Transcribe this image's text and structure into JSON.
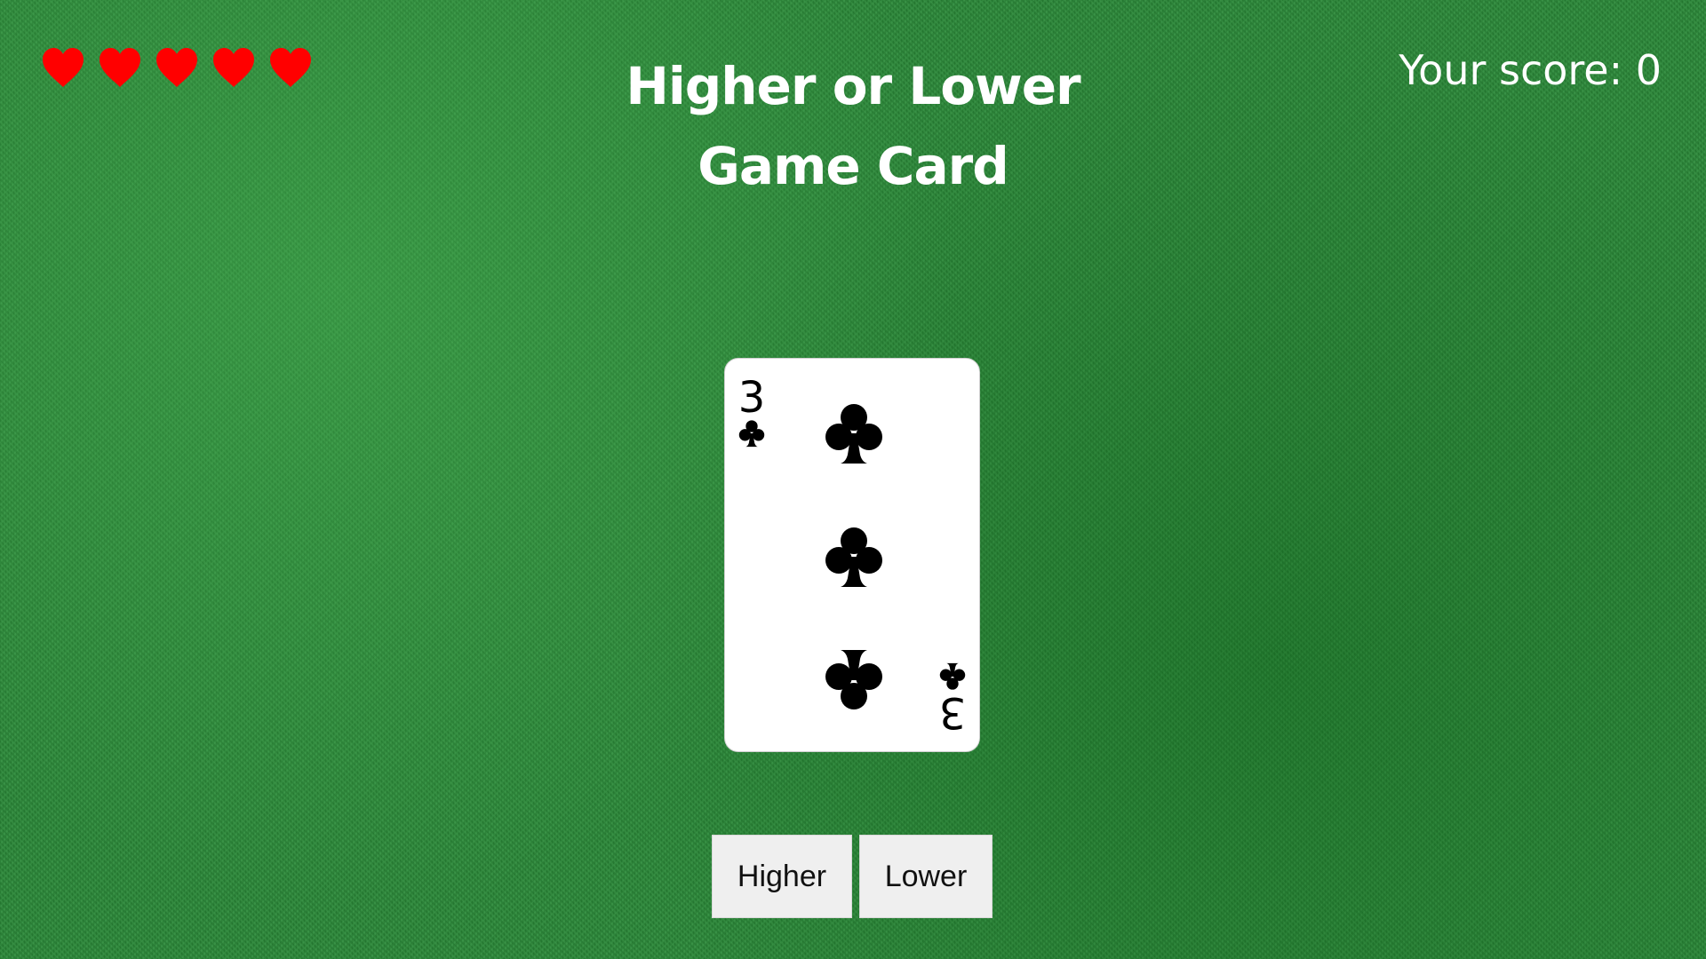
{
  "game": {
    "title_line1": "Higher or Lower",
    "title_line2": "Game Card",
    "score_label": "Your score: 0",
    "score": 0,
    "lives": 5,
    "life_icon": "heart-icon",
    "life_color": "#ff0000"
  },
  "card": {
    "rank": "3",
    "suit": "clubs",
    "suit_icon": "club-icon",
    "color": "#000000"
  },
  "controls": {
    "higher_label": "Higher",
    "lower_label": "Lower"
  }
}
